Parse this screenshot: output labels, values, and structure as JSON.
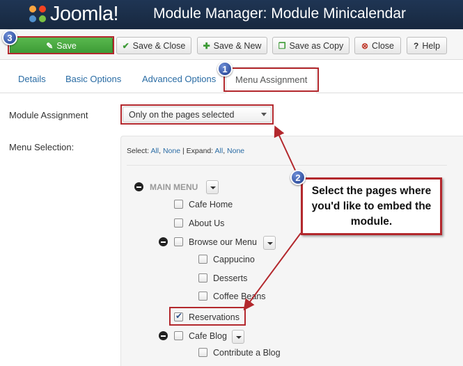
{
  "header": {
    "logo_text": "Joomla!",
    "title": "Module Manager: Module Minicalendar"
  },
  "toolbar": {
    "save_label": "Save",
    "save_close_label": "Save & Close",
    "save_new_label": "Save & New",
    "save_copy_label": "Save as Copy",
    "close_label": "Close",
    "help_label": "Help"
  },
  "tabs": [
    {
      "label": "Details"
    },
    {
      "label": "Basic Options"
    },
    {
      "label": "Advanced Options"
    },
    {
      "label": "Menu Assignment"
    }
  ],
  "form": {
    "module_assignment_label": "Module Assignment",
    "module_assignment_value": "Only on the pages selected",
    "menu_selection_label": "Menu Selection:"
  },
  "selection_bar": {
    "select_prefix": "Select:",
    "all": "All",
    "none": "None",
    "expand_prefix": "Expand:"
  },
  "menu_tree": {
    "main_menu": "MAIN MENU",
    "items": [
      {
        "label": "Cafe Home",
        "checked": false
      },
      {
        "label": "About Us",
        "checked": false
      },
      {
        "label": "Browse our Menu",
        "checked": false
      },
      {
        "label": "Cappucino",
        "checked": false
      },
      {
        "label": "Desserts",
        "checked": false
      },
      {
        "label": "Coffee Beans",
        "checked": false
      },
      {
        "label": "Reservations",
        "checked": true
      },
      {
        "label": "Cafe Blog",
        "checked": false
      },
      {
        "label": "Contribute a Blog",
        "checked": false
      }
    ]
  },
  "annotations": {
    "badge_1": "1",
    "badge_2": "2",
    "badge_3": "3",
    "callout_text": "Select the pages where you'd like to embed the module."
  },
  "colors": {
    "header_bg": "#1c2f4a",
    "save_green": "#3c9a35",
    "link_blue": "#2a6ca4",
    "annotation_red": "#b3282d"
  }
}
